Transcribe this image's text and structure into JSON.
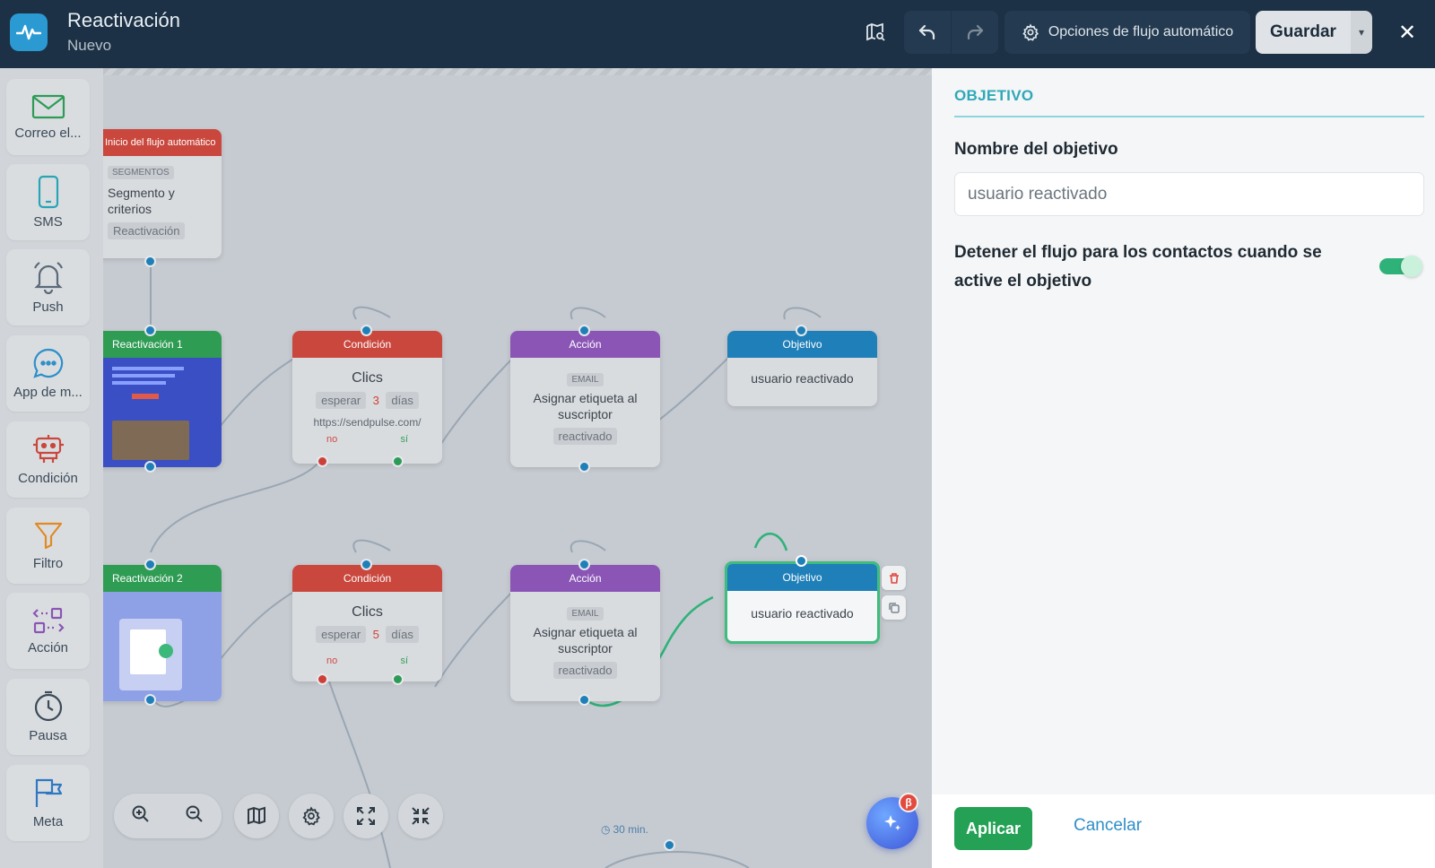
{
  "header": {
    "title": "Reactivación",
    "subtitle": "Nuevo",
    "options_label": "Opciones de flujo automático",
    "save_label": "Guardar"
  },
  "sidebar": {
    "items": [
      {
        "label": "Correo el...",
        "icon": "envelope-icon"
      },
      {
        "label": "SMS",
        "icon": "phone-icon"
      },
      {
        "label": "Push",
        "icon": "bell-icon"
      },
      {
        "label": "App de m...",
        "icon": "chat-bubble-icon"
      },
      {
        "label": "Condición",
        "icon": "robot-icon"
      },
      {
        "label": "Filtro",
        "icon": "funnel-icon"
      },
      {
        "label": "Acción",
        "icon": "code-arrows-icon"
      },
      {
        "label": "Pausa",
        "icon": "clock-icon"
      },
      {
        "label": "Meta",
        "icon": "flag-icon"
      }
    ]
  },
  "canvas": {
    "start": {
      "header": "Inicio del flujo automático",
      "tag": "SEGMENTOS",
      "title": "Segmento y criterios",
      "chip": "Reactivación"
    },
    "email1": {
      "header": "Reactivación 1"
    },
    "email2": {
      "header": "Reactivación 2"
    },
    "cond1": {
      "header": "Condición",
      "title": "Clics",
      "wait_word": "esperar",
      "wait_num": "3",
      "wait_unit": "días",
      "url": "https://sendpulse.com/",
      "no": "no",
      "si": "sí"
    },
    "cond2": {
      "header": "Condición",
      "title": "Clics",
      "wait_word": "esperar",
      "wait_num": "5",
      "wait_unit": "días",
      "no": "no",
      "si": "sí"
    },
    "action1": {
      "header": "Acción",
      "tag": "EMAIL",
      "title": "Asignar etiqueta al suscriptor",
      "chip": "reactivado"
    },
    "action2": {
      "header": "Acción",
      "tag": "EMAIL",
      "title": "Asignar etiqueta al suscriptor",
      "chip": "reactivado"
    },
    "goal1": {
      "header": "Objetivo",
      "title": "usuario reactivado"
    },
    "goal2": {
      "header": "Objetivo",
      "title": "usuario reactivado"
    },
    "timer": "30 min.",
    "ai_badge": "β"
  },
  "panel": {
    "section": "OBJETIVO",
    "name_label": "Nombre del objetivo",
    "name_value": "usuario reactivado",
    "toggle_label": "Detener el flujo para los contactos cuando se active el objetivo",
    "toggle_on": true,
    "apply_label": "Aplicar",
    "cancel_label": "Cancelar"
  },
  "colors": {
    "topbar": "#1c3145",
    "condition": "#c9473d",
    "email": "#2f9c54",
    "action": "#8a55b5",
    "goal": "#1f7fb8",
    "apply": "#24a155",
    "accent": "#2ea8b8"
  }
}
